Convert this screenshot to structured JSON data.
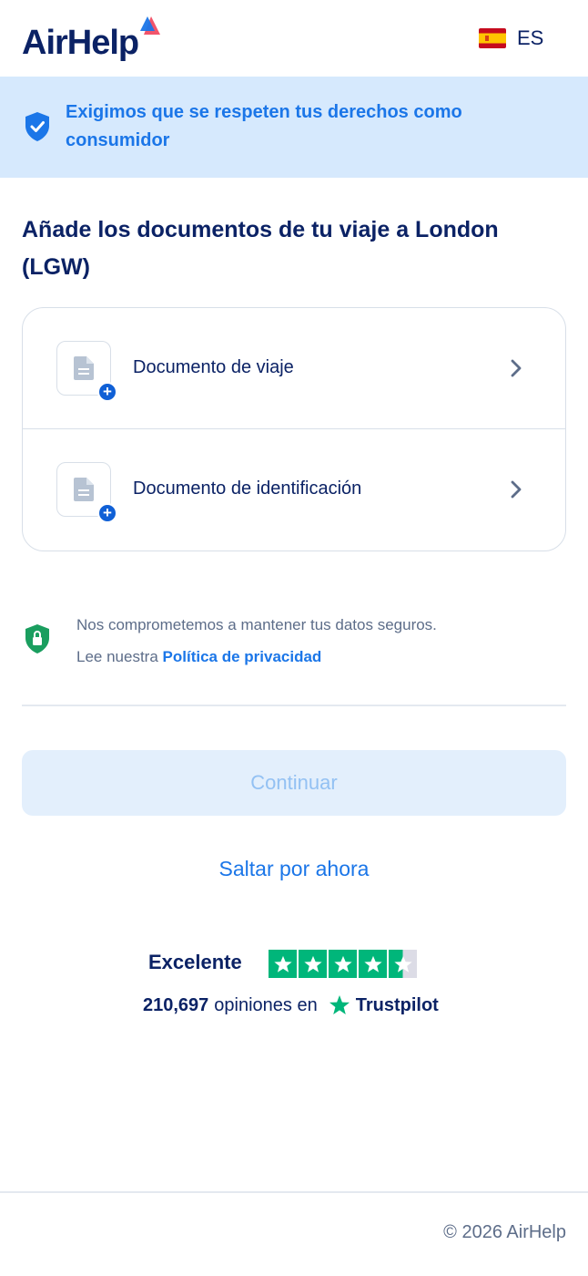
{
  "header": {
    "logo_text": "AirHelp",
    "language_code": "ES",
    "flag_icon": "spain-flag-icon"
  },
  "banner": {
    "icon": "shield-check-icon",
    "text": "Exigimos que se respeten tus derechos como consumidor"
  },
  "title": "Añade los documentos de tu viaje a London (LGW)",
  "documents": [
    {
      "label": "Documento de viaje",
      "icon": "document-icon",
      "badge": "+",
      "action_icon": "chevron-right-icon"
    },
    {
      "label": "Documento de identificación",
      "icon": "document-icon",
      "badge": "+",
      "action_icon": "chevron-right-icon"
    }
  ],
  "privacy": {
    "icon": "lock-shield-icon",
    "line1": "Nos comprometemos a mantener tus datos seguros.",
    "line2_prefix": "Lee nuestra",
    "link": "Política de privacidad"
  },
  "actions": {
    "continue_label": "Continuar",
    "skip_label": "Saltar por ahora"
  },
  "trustpilot": {
    "rating_text": "Excelente",
    "stars": 4.5,
    "review_count": "210,697",
    "reviews_label": "opiniones en",
    "brand": "Trustpilot"
  },
  "footer": {
    "copyright": "© 2026 AirHelp"
  },
  "colors": {
    "brand_navy": "#0b2265",
    "brand_blue": "#1b76e8",
    "banner_bg": "#d6e9fd",
    "trustpilot_green": "#00b67a",
    "disabled_button_bg": "#e3effc"
  }
}
